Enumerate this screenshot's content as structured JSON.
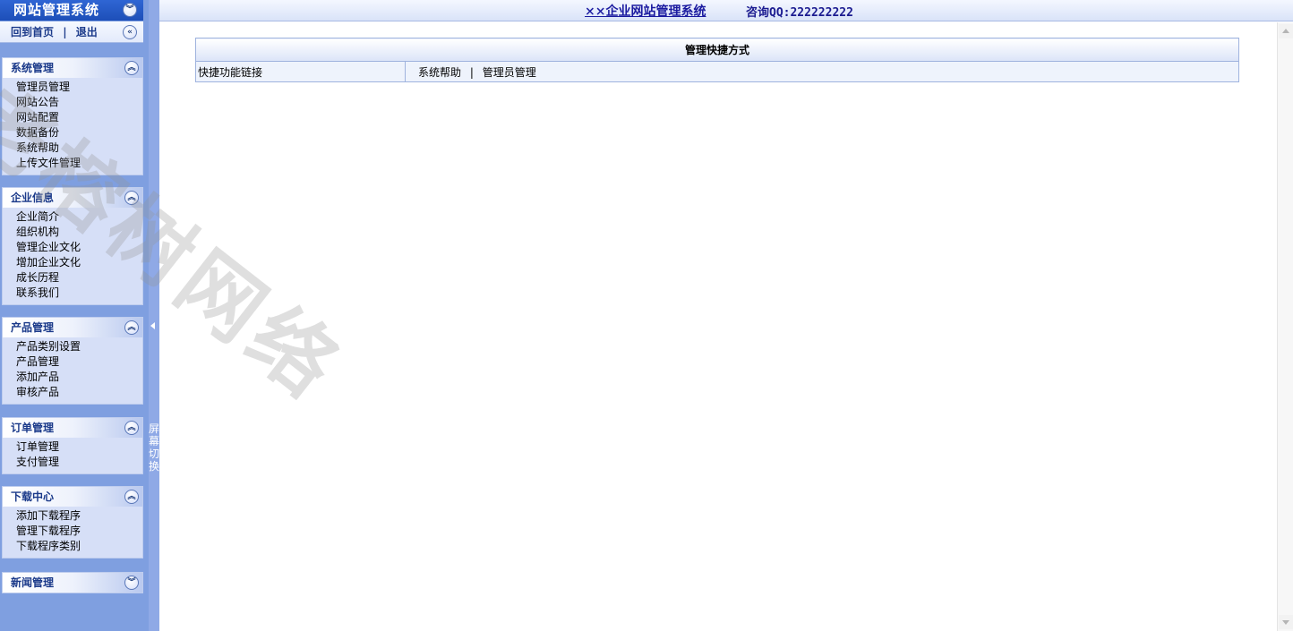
{
  "sidebar": {
    "title": "网站管理系统",
    "collapse_icon": "double-chevron-down-icon",
    "home_link": "回到首页",
    "separator": "|",
    "logout_link": "退出",
    "hide_icon": "double-chevron-left-icon",
    "groups": [
      {
        "title": "系统管理",
        "state": "expanded",
        "items": [
          "管理员管理",
          "网站公告",
          "网站配置",
          "数据备份",
          "系统帮助",
          "上传文件管理"
        ]
      },
      {
        "title": "企业信息",
        "state": "expanded",
        "items": [
          "企业简介",
          "组织机构",
          "管理企业文化",
          "增加企业文化",
          "成长历程",
          "联系我们"
        ]
      },
      {
        "title": "产品管理",
        "state": "expanded",
        "items": [
          "产品类别设置",
          "产品管理",
          "添加产品",
          "审核产品"
        ]
      },
      {
        "title": "订单管理",
        "state": "expanded",
        "items": [
          "订单管理",
          "支付管理"
        ]
      },
      {
        "title": "下载中心",
        "state": "expanded",
        "items": [
          "添加下载程序",
          "管理下载程序",
          "下载程序类别"
        ]
      },
      {
        "title": "新闻管理",
        "state": "collapsed",
        "items": []
      }
    ]
  },
  "splitter": {
    "switch_text": "屏幕切换",
    "arrow_icon": "triangle-left-icon"
  },
  "header": {
    "site_title": "××企业网站管理系统",
    "qq_label": "咨询QQ:222222222"
  },
  "main": {
    "table_title": "管理快捷方式",
    "row_label": "快捷功能链接",
    "links": [
      "系统帮助",
      "管理员管理"
    ],
    "link_separator": "|"
  },
  "watermark": "老榕树网络",
  "colors": {
    "sidebar_bg": "#7f9fe0",
    "title_bar": "#1d4fb8",
    "menu_bg": "#d6dff7",
    "link_blue": "#1b1ba0"
  }
}
